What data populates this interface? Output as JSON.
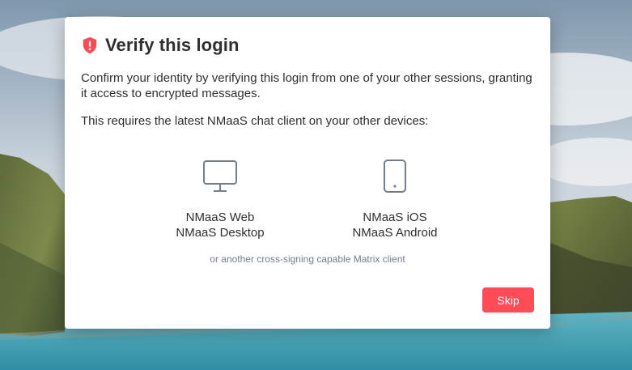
{
  "dialog": {
    "title": "Verify this login",
    "description": "Confirm your identity by verifying this login from one of your other sessions, granting it access to encrypted messages.",
    "requirement": "This requires the latest NMaaS chat client on your other devices:",
    "desktop_clients": {
      "line1": "NMaaS Web",
      "line2": "NMaaS Desktop"
    },
    "mobile_clients": {
      "line1": "NMaaS iOS",
      "line2": "NMaaS Android"
    },
    "note": "or another cross-signing capable Matrix client",
    "skip_label": "Skip"
  },
  "colors": {
    "accent": "#ff4b55",
    "text": "#2e2f32",
    "muted": "#737d8c",
    "icon": "#737d8c"
  },
  "icons": {
    "title": "shield-warning-icon",
    "desktop": "monitor-icon",
    "mobile": "phone-icon"
  }
}
